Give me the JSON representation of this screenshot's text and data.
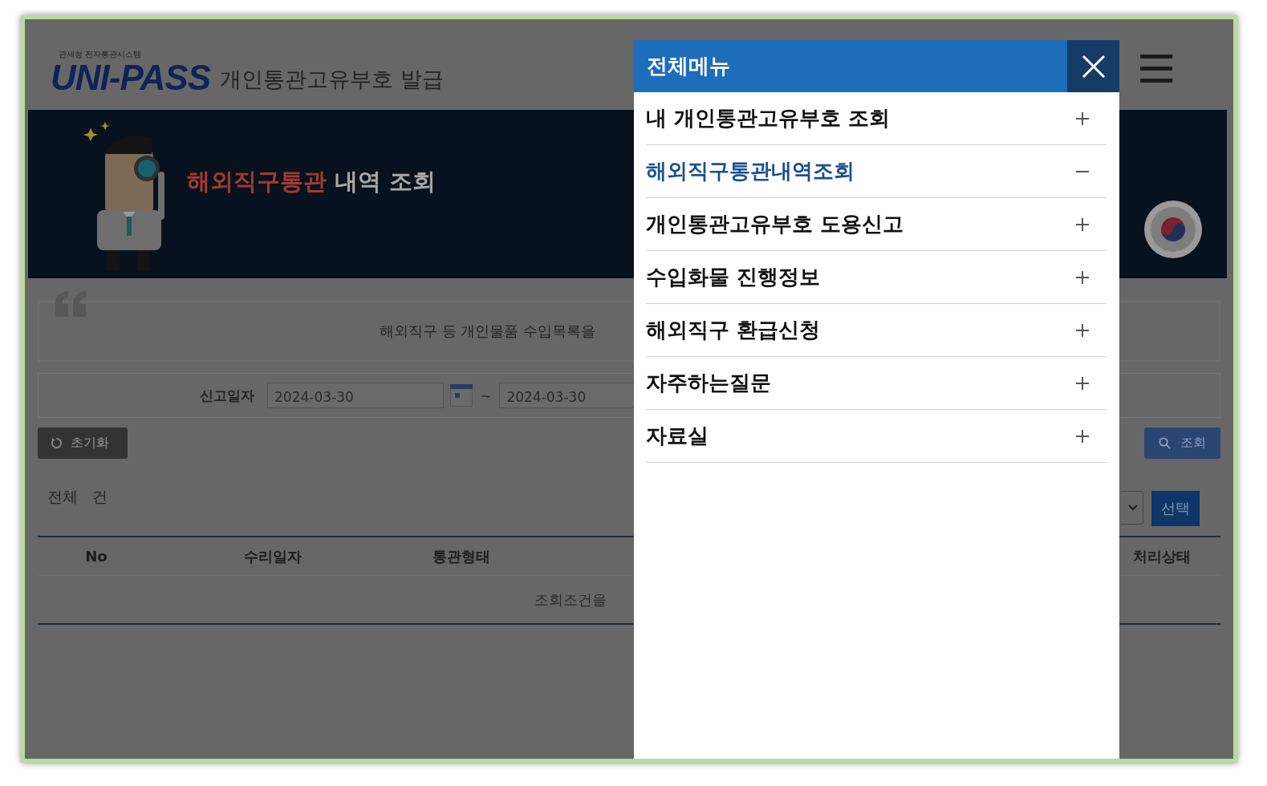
{
  "header": {
    "agency": "관세청 전자통관시스템",
    "logo": "UNI-PASS",
    "title": "개인통관고유부호 발급"
  },
  "banner": {
    "title_highlight": "해외직구통관",
    "title_rest": "내역 조회"
  },
  "notice": {
    "text": "해외직구 등 개인물품 수입목록을"
  },
  "search_form": {
    "label": "신고일자",
    "date_from": "2024-03-30",
    "separator": "~",
    "date_to": "2024-03-30"
  },
  "buttons": {
    "reset": "초기화",
    "search": "조회",
    "select": "선택"
  },
  "result": {
    "total_label": "전체",
    "unit": "건"
  },
  "table": {
    "columns": [
      "No",
      "수리일자",
      "통관형태",
      "처리상태"
    ],
    "empty_message": "조회조건을"
  },
  "menu": {
    "title": "전체메뉴",
    "items": [
      {
        "label": "내 개인통관고유부호 조회",
        "expanded": false
      },
      {
        "label": "해외직구통관내역조회",
        "expanded": true
      },
      {
        "label": "개인통관고유부호 도용신고",
        "expanded": false
      },
      {
        "label": "수입화물 진행정보",
        "expanded": false
      },
      {
        "label": "해외직구 환급신청",
        "expanded": false
      },
      {
        "label": "자주하는질문",
        "expanded": false
      },
      {
        "label": "자료실",
        "expanded": false
      }
    ]
  }
}
